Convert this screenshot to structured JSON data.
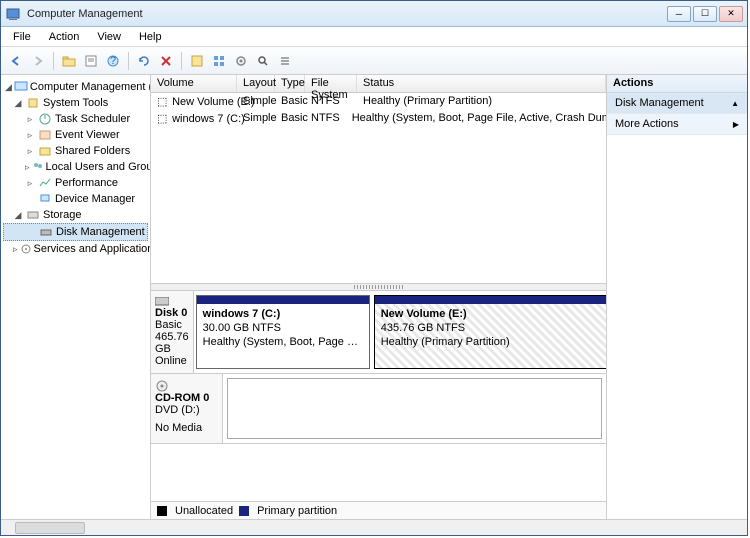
{
  "window": {
    "title": "Computer Management"
  },
  "menu": {
    "file": "File",
    "action": "Action",
    "view": "View",
    "help": "Help"
  },
  "tree": {
    "root": "Computer Management (Local)",
    "systools": "System Tools",
    "taskScheduler": "Task Scheduler",
    "eventViewer": "Event Viewer",
    "sharedFolders": "Shared Folders",
    "localUsers": "Local Users and Groups",
    "performance": "Performance",
    "deviceManager": "Device Manager",
    "storage": "Storage",
    "diskManagement": "Disk Management",
    "services": "Services and Applications"
  },
  "volHeaders": {
    "volume": "Volume",
    "layout": "Layout",
    "type": "Type",
    "fs": "File System",
    "status": "Status"
  },
  "volumes": [
    {
      "name": "New Volume (E:)",
      "layout": "Simple",
      "type": "Basic",
      "fs": "NTFS",
      "status": "Healthy (Primary Partition)"
    },
    {
      "name": "windows 7 (C:)",
      "layout": "Simple",
      "type": "Basic",
      "fs": "NTFS",
      "status": "Healthy (System, Boot, Page File, Active, Crash Dump, Primary Partition)"
    }
  ],
  "disk0": {
    "name": "Disk 0",
    "type": "Basic",
    "size": "465.76 GB",
    "state": "Online",
    "parts": [
      {
        "name": "windows 7  (C:)",
        "size": "30.00 GB NTFS",
        "status": "Healthy (System, Boot, Page File, Active, Crash Dump, Primary Partition)"
      },
      {
        "name": "New Volume  (E:)",
        "size": "435.76 GB NTFS",
        "status": "Healthy (Primary Partition)"
      }
    ]
  },
  "cdrom": {
    "name": "CD-ROM 0",
    "drive": "DVD (D:)",
    "state": "No Media"
  },
  "legend": {
    "unalloc": "Unallocated",
    "primary": "Primary partition"
  },
  "actions": {
    "header": "Actions",
    "dm": "Disk Management",
    "more": "More Actions"
  }
}
